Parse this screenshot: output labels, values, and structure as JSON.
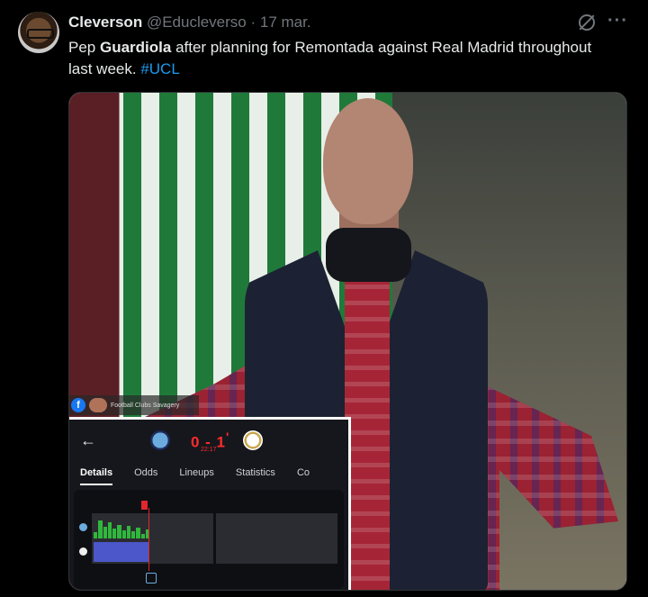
{
  "tweet": {
    "author_name": "Cleverson",
    "handle": "@Educleverso",
    "separator": "·",
    "time": "17 mar.",
    "text_before": "Pep ",
    "text_bold": "Guardiola",
    "text_after": " after planning for Remontada against Real Madrid throughout last week. ",
    "hashtag": "#UCL"
  },
  "icons": {
    "grok": "grok-icon",
    "more": "more-icon",
    "more_glyph": "···"
  },
  "media": {
    "watermark": "Football Clubs Savagery",
    "watermark_fb": "f",
    "match": {
      "score": "0 - 1",
      "score_superscript": "'",
      "clock": "22:17",
      "tabs": [
        "Details",
        "Odds",
        "Lineups",
        "Statistics",
        "Co"
      ],
      "active_tab": "Details"
    }
  }
}
